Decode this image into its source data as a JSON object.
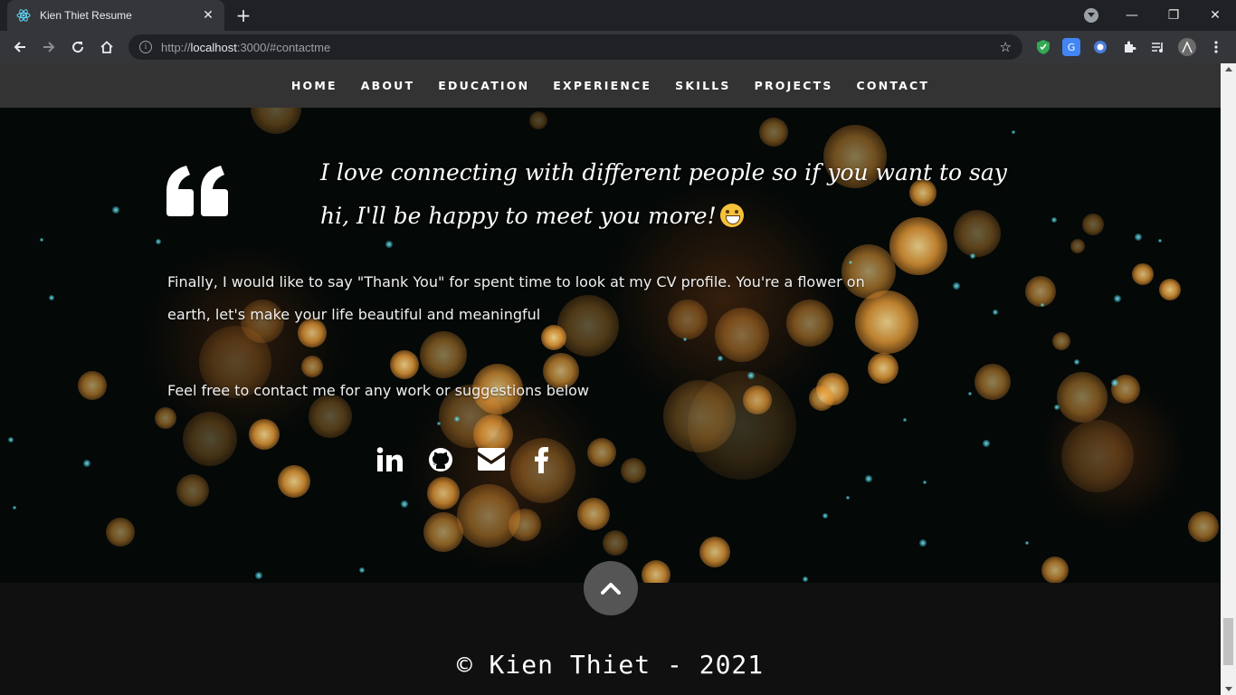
{
  "browser": {
    "tab_title": "Kien Thiet Resume",
    "tab_close": "✕",
    "new_tab": "+",
    "url_scheme": "http://",
    "url_host": "localhost",
    "url_rest": ":3000/#contactme",
    "window_controls": {
      "minimize": "—",
      "restore": "❐",
      "close": "✕"
    }
  },
  "nav": {
    "items": [
      "HOME",
      "ABOUT",
      "EDUCATION",
      "EXPERIENCE",
      "SKILLS",
      "PROJECTS",
      "CONTACT"
    ]
  },
  "contact": {
    "quote": "I love connecting with different people so if you want to say hi, I'll be happy to meet you more!",
    "paragraph1": "Finally, I would like to say \"Thank You\" for spent time to look at my CV profile. You're a flower on earth, let's make your life beautiful and meaningful",
    "paragraph2": "Feel free to contact me for any work or suggestions below",
    "socials": [
      "linkedin-icon",
      "github-icon",
      "email-icon",
      "facebook-icon"
    ]
  },
  "footer": {
    "copyright": "© Kien Thiet - 2021"
  },
  "colors": {
    "nav_bg": "#333333",
    "contact_bg": "#040807",
    "footer_bg": "#101010",
    "bokeh_orange": "#f5a53a",
    "bokeh_cyan": "#3ecfe0"
  }
}
